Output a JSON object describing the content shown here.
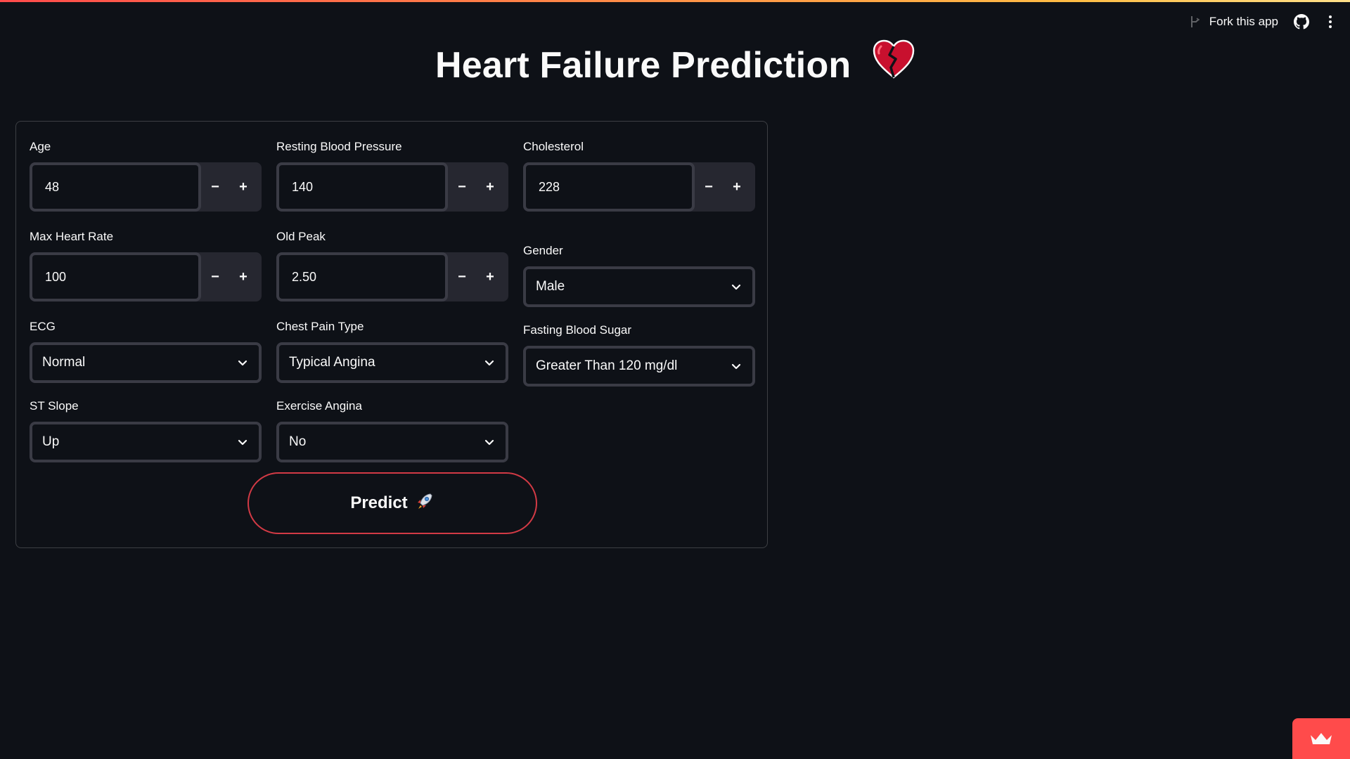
{
  "header": {
    "fork_label": "Fork this app",
    "icons": [
      "fork-icon",
      "github-icon",
      "kebab-menu-icon"
    ]
  },
  "page": {
    "title": "Heart Failure Prediction",
    "title_emoji": "broken-heart-icon"
  },
  "form": {
    "age": {
      "label": "Age",
      "value": "48"
    },
    "resting_bp": {
      "label": "Resting Blood Pressure",
      "value": "140"
    },
    "cholesterol": {
      "label": "Cholesterol",
      "value": "228"
    },
    "max_hr": {
      "label": "Max Heart Rate",
      "value": "100"
    },
    "old_peak": {
      "label": "Old Peak",
      "value": "2.50"
    },
    "gender": {
      "label": "Gender",
      "value": "Male"
    },
    "ecg": {
      "label": "ECG",
      "value": "Normal"
    },
    "chest_pain": {
      "label": "Chest Pain Type",
      "value": "Typical Angina"
    },
    "fasting_bs": {
      "label": "Fasting Blood Sugar",
      "value": "Greater Than 120 mg/dl"
    },
    "st_slope": {
      "label": "ST Slope",
      "value": "Up"
    },
    "exercise_angina": {
      "label": "Exercise Angina",
      "value": "No"
    },
    "stepper": {
      "minus": "−",
      "plus": "+"
    },
    "predict_label": "Predict"
  },
  "colors": {
    "background": "#0e1117",
    "accent": "#ff4b4b",
    "input_border": "#3a3b45",
    "stepper_bg": "#262730"
  }
}
